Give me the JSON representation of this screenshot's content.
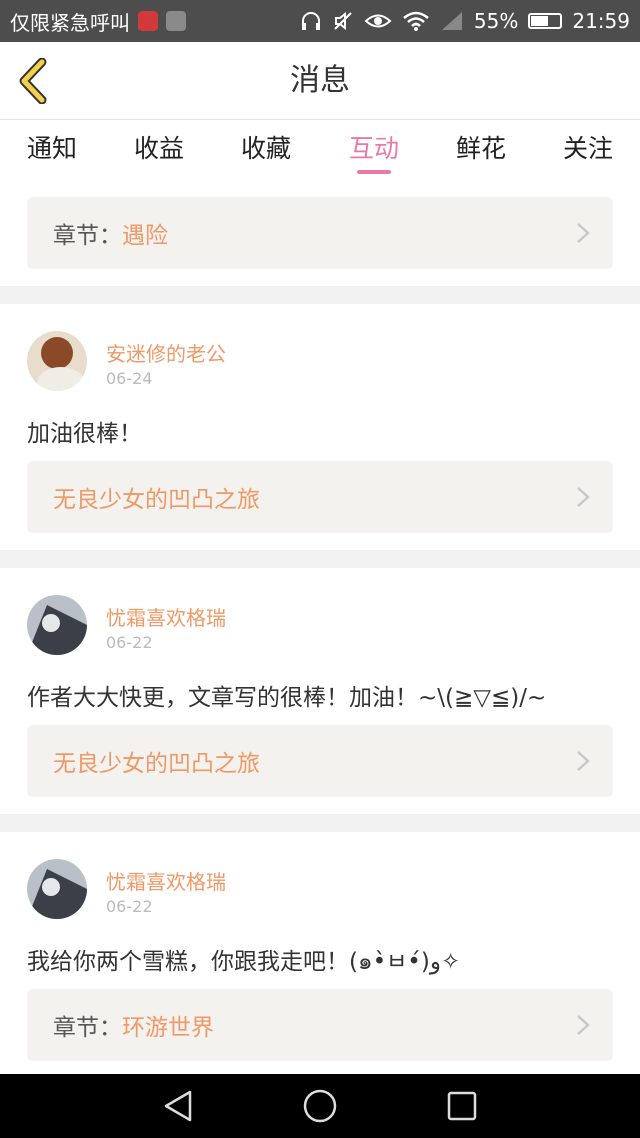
{
  "status_bar": {
    "carrier": "仅限紧急呼叫",
    "battery": "55%",
    "time": "21:59"
  },
  "header": {
    "title": "消息",
    "back_icon": "chevron-left-icon"
  },
  "tabs": [
    {
      "label": "通知",
      "active": false
    },
    {
      "label": "收益",
      "active": false
    },
    {
      "label": "收藏",
      "active": false
    },
    {
      "label": "互动",
      "active": true
    },
    {
      "label": "鲜花",
      "active": false
    },
    {
      "label": "关注",
      "active": false
    }
  ],
  "first_card": {
    "link_prefix": "章节：",
    "link_name": "遇险"
  },
  "messages": [
    {
      "user": "安迷修的老公",
      "date": "06-24",
      "text": "加油很棒！",
      "link_prefix": "",
      "link_name": "无良少女的凹凸之旅"
    },
    {
      "user": "忧霜喜欢格瑞",
      "date": "06-22",
      "text": "作者大大快更，文章写的很棒！加油！~\\(≧▽≦)/~",
      "link_prefix": "",
      "link_name": "无良少女的凹凸之旅"
    },
    {
      "user": "忧霜喜欢格瑞",
      "date": "06-22",
      "text": "我给你两个雪糕，你跟我走吧！(๑•̀ㅂ•́)و✧",
      "link_prefix": "章节：",
      "link_name": "环游世界"
    }
  ],
  "colors": {
    "accent": "#e879a8",
    "username": "#ef9966",
    "link_bg": "#f4f2ee"
  }
}
